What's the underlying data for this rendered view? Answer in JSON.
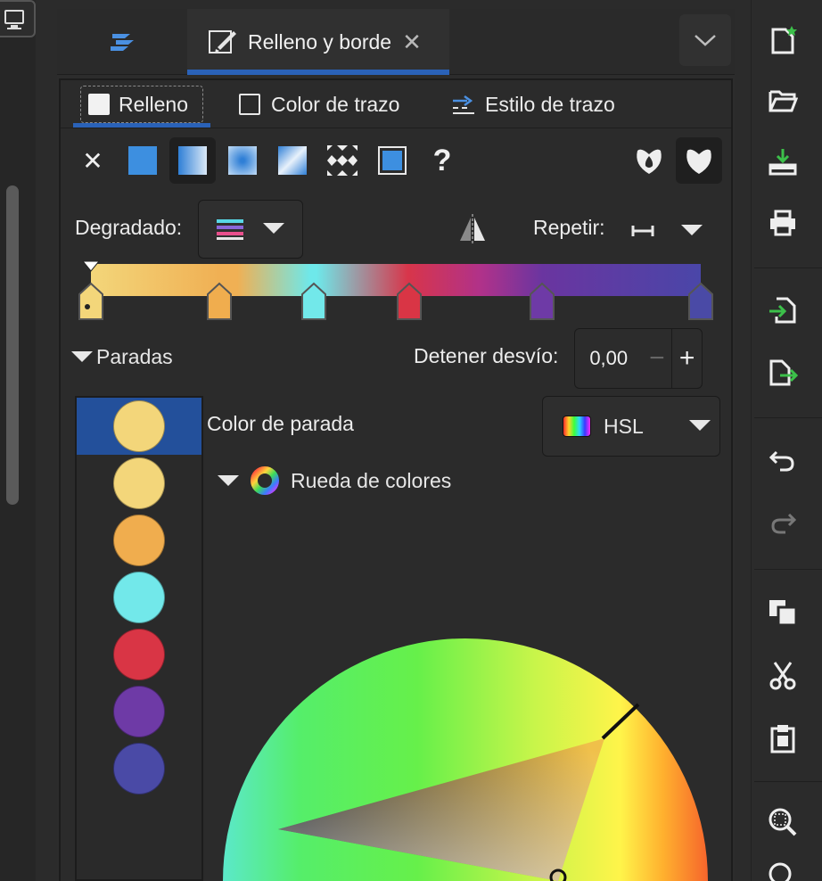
{
  "dock_tab": {
    "title": "Relleno y borde",
    "close": "✕"
  },
  "subtabs": {
    "fill": "Relleno",
    "stroke_paint": "Color de trazo",
    "stroke_style": "Estilo de trazo"
  },
  "paint_types": [
    "no-paint",
    "flat-color",
    "linear-gradient",
    "radial-gradient",
    "mesh-gradient",
    "pattern",
    "swatch",
    "unset"
  ],
  "unset_glyph": "?",
  "no_paint_glyph": "✕",
  "gradient": {
    "label": "Degradado:",
    "repeat_label": "Repetir:"
  },
  "stops": {
    "header": "Paradas",
    "offset_label": "Detener desvío:",
    "offset_value": "0,00",
    "minus": "−",
    "plus": "+",
    "colors": [
      "#f3d67a",
      "#f3d67a",
      "#f0ad4e",
      "#72e8ea",
      "#d93545",
      "#6e3aa6",
      "#4a4aa6"
    ],
    "selected_index": 0
  },
  "stop_color": {
    "label": "Color de parada",
    "mode": "HSL",
    "wheel_label": "Rueda de colores"
  },
  "colors": {
    "accent": "#2a62b8",
    "selected_row": "#23509b",
    "panel": "#2b2b2b"
  }
}
